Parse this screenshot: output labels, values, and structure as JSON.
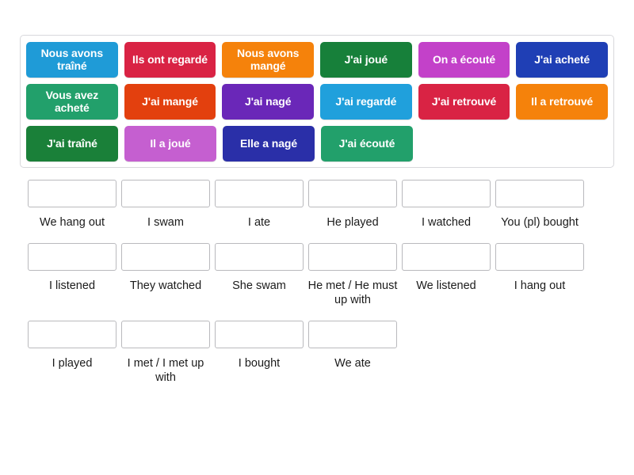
{
  "activity": {
    "type": "match-up",
    "background_color": "#ffffff"
  },
  "tile_bank": {
    "border_color": "#d8d8dc",
    "rows": [
      [
        {
          "label": "Nous avons traîné",
          "color": "#1f9bd7"
        },
        {
          "label": "Ils ont regardé",
          "color": "#d92344"
        },
        {
          "label": "Nous avons mangé",
          "color": "#f5820b"
        },
        {
          "label": "J'ai joué",
          "color": "#17803a"
        },
        {
          "label": "On a écouté",
          "color": "#c341c9"
        },
        {
          "label": "J'ai acheté",
          "color": "#1f3fb5"
        }
      ],
      [
        {
          "label": "Vous avez acheté",
          "color": "#22a06b"
        },
        {
          "label": "J'ai mangé",
          "color": "#e3400e"
        },
        {
          "label": "J'ai nagé",
          "color": "#6a27b8"
        },
        {
          "label": "J'ai regardé",
          "color": "#20a0dc"
        },
        {
          "label": "J'ai retrouvé",
          "color": "#d92344"
        },
        {
          "label": "Il a retrouvé",
          "color": "#f5820b"
        }
      ],
      [
        {
          "label": "J'ai traîné",
          "color": "#1a8039"
        },
        {
          "label": "Il a joué",
          "color": "#c55fd0"
        },
        {
          "label": "Elle a nagé",
          "color": "#2a2fa8"
        },
        {
          "label": "J'ai écouté",
          "color": "#22a06b"
        }
      ]
    ]
  },
  "answers": {
    "rows": [
      [
        {
          "label": "We hang out",
          "value": ""
        },
        {
          "label": "I swam",
          "value": ""
        },
        {
          "label": "I ate",
          "value": ""
        },
        {
          "label": "He played",
          "value": ""
        },
        {
          "label": "I watched",
          "value": ""
        },
        {
          "label": "You (pl) bought",
          "value": ""
        }
      ],
      [
        {
          "label": "I listened",
          "value": ""
        },
        {
          "label": "They watched",
          "value": ""
        },
        {
          "label": "She swam",
          "value": ""
        },
        {
          "label": "He met / He must up with",
          "value": ""
        },
        {
          "label": "We listened",
          "value": ""
        },
        {
          "label": "I hang out",
          "value": ""
        }
      ],
      [
        {
          "label": "I played",
          "value": ""
        },
        {
          "label": "I met / I met up with",
          "value": ""
        },
        {
          "label": "I bought",
          "value": ""
        },
        {
          "label": "We ate",
          "value": ""
        }
      ]
    ]
  }
}
